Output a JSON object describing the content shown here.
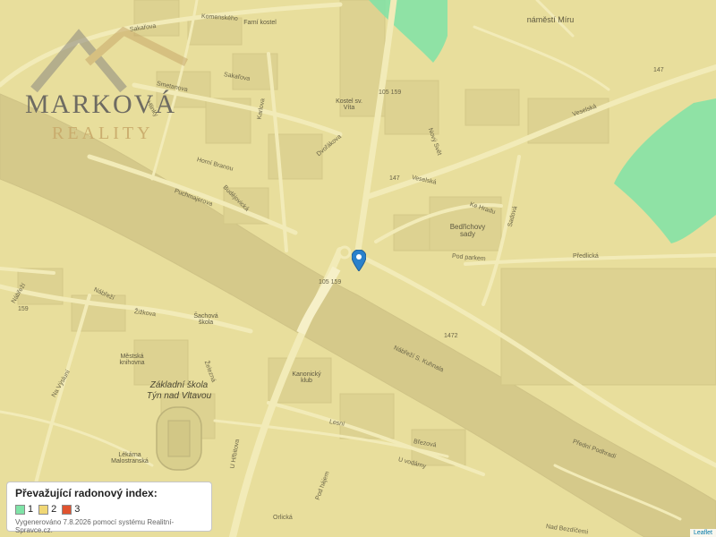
{
  "map": {
    "watermark": {
      "name_line": "MARKOVÁ",
      "sub_line": "REALITY"
    },
    "zones": {
      "index_1_color": "#7fe3a7",
      "index_2_color": "#e8de9c"
    },
    "street_labels": {
      "sakarova_1": "Sakařova",
      "sakarova_2": "Sakařova",
      "komenskeho": "Komenského",
      "hlinky": "Hlinky",
      "karlova": "Karlova",
      "smetanova": "Smetanova",
      "dvorakova": "Dvořákova",
      "horni_branou": "Horní Branou",
      "puchmajerova": "Puchmajerova",
      "budejovicka": "Budějovická",
      "zizkova": "Žižkova",
      "nabrezi_1": "Nábřeží",
      "nabrezi_2": "Nábřeží",
      "veselska_1": "Veselská",
      "veselska_2": "Veselská",
      "ke_hradu": "Ke Hradu",
      "pod_parkem": "Pod parkem",
      "predlicka": "Předlická",
      "novy_svet": "Nový Svět",
      "na_vysluni": "Na Výsluní",
      "zelezna": "Železná",
      "sadova": "Sadová",
      "u_hrbitova": "U Hřbitova",
      "u_vodarny": "U vodárny",
      "orlicka": "Orlická",
      "nad_bezdicemi": "Nad Bezdíčemi",
      "brezova": "Březová",
      "lesni": "Lesní",
      "pod_hajem": "Pod hájem",
      "nabrezi_s_kuhnala": "Nábřeží S. Kuhnala",
      "predni_podhradi": "Přední Podhradí"
    },
    "road_numbers": {
      "r105_159_top": "105 159",
      "r105_159_bridge": "105 159",
      "r147_top": "147",
      "r147_mid": "147",
      "r1472": "1472",
      "r159_left": "159"
    },
    "place_labels": {
      "square": "náměstí Míru",
      "church": "Kostel sv. Víta",
      "church_small": "Farní kostel",
      "castle_park": "Bedřichovy sady",
      "mestska_knihovna": "Městská knihovna",
      "kanonicky": "Kanonický klub",
      "lekarna": "Lékárna Malostranská",
      "sachova_skola": "Šachová škola"
    },
    "school": "Základní škola Týn nad Vltavou"
  },
  "legend": {
    "title": "Převažující radonový index:",
    "items": [
      {
        "label": "1",
        "color": "#7fe3a7"
      },
      {
        "label": "2",
        "color": "#f0d775"
      },
      {
        "label": "3",
        "color": "#e0532f"
      }
    ],
    "note": "Vygenerováno 7.8.2026 pomocí systému Realitní-Spravce.cz."
  },
  "attribution": "Leaflet"
}
